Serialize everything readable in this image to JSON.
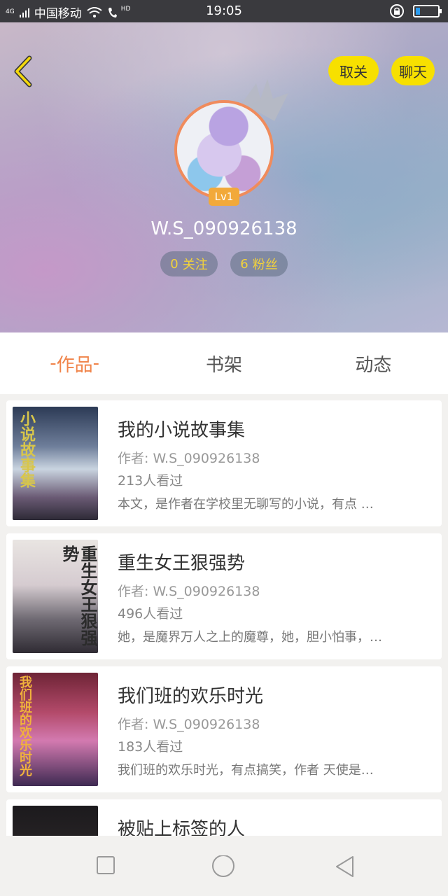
{
  "status_bar": {
    "network": "4G",
    "carrier": "中国移动",
    "hd": "HD",
    "time": "19:05",
    "battery_level": 0.2
  },
  "header": {
    "unfollow_label": "取关",
    "chat_label": "聊天",
    "level_badge": "Lv1",
    "username": "W.S_090926138",
    "following_count": "0",
    "following_label": "关注",
    "fans_count": "6",
    "fans_label": "粉丝",
    "accent_color": "#f7e000"
  },
  "tabs": [
    {
      "label": "作品",
      "active": true
    },
    {
      "label": "书架",
      "active": false
    },
    {
      "label": "动态",
      "active": false
    }
  ],
  "works": [
    {
      "title": "我的小说故事集",
      "author": "作者: W.S_090926138",
      "views": "213人看过",
      "desc": "本文，是作者在学校里无聊写的小说，有点 …",
      "cover_text": "小说故事集"
    },
    {
      "title": "重生女王狠强势",
      "author": "作者: W.S_090926138",
      "views": "496人看过",
      "desc": "她，是魔界万人之上的魔尊，她，胆小怕事，…",
      "cover_text": "重生女王狠强势"
    },
    {
      "title": "我们班的欢乐时光",
      "author": "作者: W.S_090926138",
      "views": "183人看过",
      "desc": "我们班的欢乐时光，有点搞笑，作者 天使是…",
      "cover_text": "我们班的欢乐时光"
    },
    {
      "title": "被贴上标签的人",
      "author": "",
      "views": "",
      "desc": "",
      "cover_text": ""
    }
  ],
  "icons": {
    "back": "chevron-left-icon",
    "crown": "crown-icon",
    "nav_recent": "square-icon",
    "nav_home": "circle-icon",
    "nav_back": "triangle-back-icon"
  }
}
